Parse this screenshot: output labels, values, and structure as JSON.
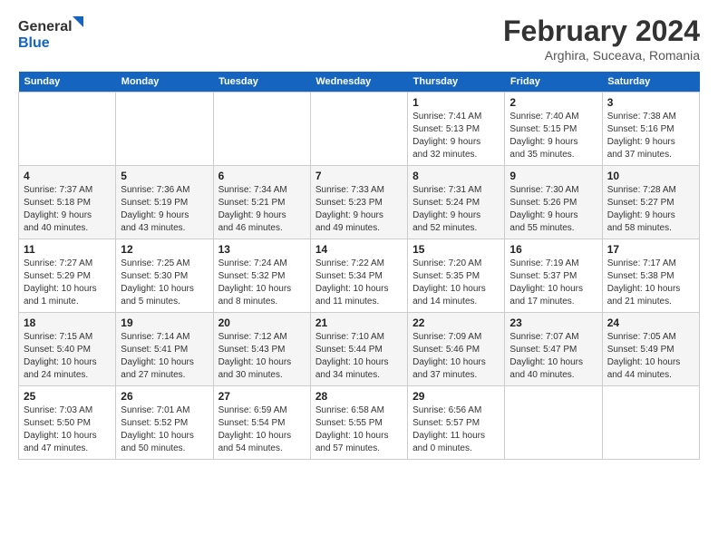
{
  "header": {
    "logo_line1": "General",
    "logo_line2": "Blue",
    "title": "February 2024",
    "location": "Arghira, Suceava, Romania"
  },
  "days_of_week": [
    "Sunday",
    "Monday",
    "Tuesday",
    "Wednesday",
    "Thursday",
    "Friday",
    "Saturday"
  ],
  "weeks": [
    [
      {
        "day": "",
        "info": ""
      },
      {
        "day": "",
        "info": ""
      },
      {
        "day": "",
        "info": ""
      },
      {
        "day": "",
        "info": ""
      },
      {
        "day": "1",
        "info": "Sunrise: 7:41 AM\nSunset: 5:13 PM\nDaylight: 9 hours\nand 32 minutes."
      },
      {
        "day": "2",
        "info": "Sunrise: 7:40 AM\nSunset: 5:15 PM\nDaylight: 9 hours\nand 35 minutes."
      },
      {
        "day": "3",
        "info": "Sunrise: 7:38 AM\nSunset: 5:16 PM\nDaylight: 9 hours\nand 37 minutes."
      }
    ],
    [
      {
        "day": "4",
        "info": "Sunrise: 7:37 AM\nSunset: 5:18 PM\nDaylight: 9 hours\nand 40 minutes."
      },
      {
        "day": "5",
        "info": "Sunrise: 7:36 AM\nSunset: 5:19 PM\nDaylight: 9 hours\nand 43 minutes."
      },
      {
        "day": "6",
        "info": "Sunrise: 7:34 AM\nSunset: 5:21 PM\nDaylight: 9 hours\nand 46 minutes."
      },
      {
        "day": "7",
        "info": "Sunrise: 7:33 AM\nSunset: 5:23 PM\nDaylight: 9 hours\nand 49 minutes."
      },
      {
        "day": "8",
        "info": "Sunrise: 7:31 AM\nSunset: 5:24 PM\nDaylight: 9 hours\nand 52 minutes."
      },
      {
        "day": "9",
        "info": "Sunrise: 7:30 AM\nSunset: 5:26 PM\nDaylight: 9 hours\nand 55 minutes."
      },
      {
        "day": "10",
        "info": "Sunrise: 7:28 AM\nSunset: 5:27 PM\nDaylight: 9 hours\nand 58 minutes."
      }
    ],
    [
      {
        "day": "11",
        "info": "Sunrise: 7:27 AM\nSunset: 5:29 PM\nDaylight: 10 hours\nand 1 minute."
      },
      {
        "day": "12",
        "info": "Sunrise: 7:25 AM\nSunset: 5:30 PM\nDaylight: 10 hours\nand 5 minutes."
      },
      {
        "day": "13",
        "info": "Sunrise: 7:24 AM\nSunset: 5:32 PM\nDaylight: 10 hours\nand 8 minutes."
      },
      {
        "day": "14",
        "info": "Sunrise: 7:22 AM\nSunset: 5:34 PM\nDaylight: 10 hours\nand 11 minutes."
      },
      {
        "day": "15",
        "info": "Sunrise: 7:20 AM\nSunset: 5:35 PM\nDaylight: 10 hours\nand 14 minutes."
      },
      {
        "day": "16",
        "info": "Sunrise: 7:19 AM\nSunset: 5:37 PM\nDaylight: 10 hours\nand 17 minutes."
      },
      {
        "day": "17",
        "info": "Sunrise: 7:17 AM\nSunset: 5:38 PM\nDaylight: 10 hours\nand 21 minutes."
      }
    ],
    [
      {
        "day": "18",
        "info": "Sunrise: 7:15 AM\nSunset: 5:40 PM\nDaylight: 10 hours\nand 24 minutes."
      },
      {
        "day": "19",
        "info": "Sunrise: 7:14 AM\nSunset: 5:41 PM\nDaylight: 10 hours\nand 27 minutes."
      },
      {
        "day": "20",
        "info": "Sunrise: 7:12 AM\nSunset: 5:43 PM\nDaylight: 10 hours\nand 30 minutes."
      },
      {
        "day": "21",
        "info": "Sunrise: 7:10 AM\nSunset: 5:44 PM\nDaylight: 10 hours\nand 34 minutes."
      },
      {
        "day": "22",
        "info": "Sunrise: 7:09 AM\nSunset: 5:46 PM\nDaylight: 10 hours\nand 37 minutes."
      },
      {
        "day": "23",
        "info": "Sunrise: 7:07 AM\nSunset: 5:47 PM\nDaylight: 10 hours\nand 40 minutes."
      },
      {
        "day": "24",
        "info": "Sunrise: 7:05 AM\nSunset: 5:49 PM\nDaylight: 10 hours\nand 44 minutes."
      }
    ],
    [
      {
        "day": "25",
        "info": "Sunrise: 7:03 AM\nSunset: 5:50 PM\nDaylight: 10 hours\nand 47 minutes."
      },
      {
        "day": "26",
        "info": "Sunrise: 7:01 AM\nSunset: 5:52 PM\nDaylight: 10 hours\nand 50 minutes."
      },
      {
        "day": "27",
        "info": "Sunrise: 6:59 AM\nSunset: 5:54 PM\nDaylight: 10 hours\nand 54 minutes."
      },
      {
        "day": "28",
        "info": "Sunrise: 6:58 AM\nSunset: 5:55 PM\nDaylight: 10 hours\nand 57 minutes."
      },
      {
        "day": "29",
        "info": "Sunrise: 6:56 AM\nSunset: 5:57 PM\nDaylight: 11 hours\nand 0 minutes."
      },
      {
        "day": "",
        "info": ""
      },
      {
        "day": "",
        "info": ""
      }
    ]
  ]
}
